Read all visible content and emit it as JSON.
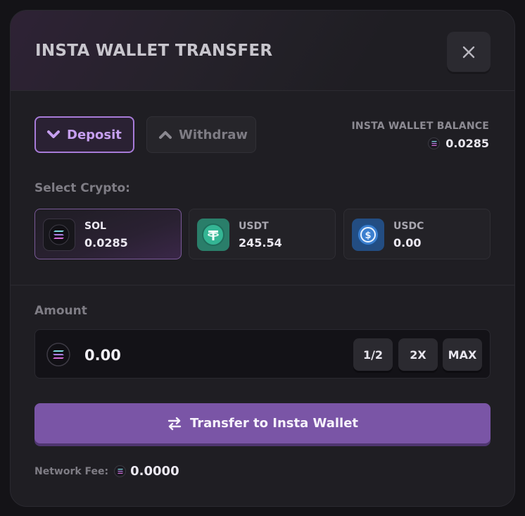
{
  "modal": {
    "title": "INSTA WALLET TRANSFER",
    "close_icon": "close-icon"
  },
  "tabs": [
    {
      "label": "Deposit",
      "icon": "chevron-down-icon",
      "active": true
    },
    {
      "label": "Withdraw",
      "icon": "chevron-up-icon",
      "active": false
    }
  ],
  "balance": {
    "label": "INSTA WALLET BALANCE",
    "value": "0.0285",
    "icon": "solana-icon"
  },
  "select_crypto": {
    "label": "Select Crypto:",
    "options": [
      {
        "name": "SOL",
        "balance": "0.0285",
        "icon": "solana-icon",
        "selected": true
      },
      {
        "name": "USDT",
        "balance": "245.54",
        "icon": "tether-icon",
        "selected": false
      },
      {
        "name": "USDC",
        "balance": "0.00",
        "icon": "usdc-icon",
        "selected": false
      }
    ]
  },
  "amount": {
    "label": "Amount",
    "value": "0.00",
    "icon": "solana-icon",
    "quick_buttons": [
      "1/2",
      "2X",
      "MAX"
    ]
  },
  "transfer_button": {
    "label": "Transfer to Insta Wallet",
    "icon": "swap-arrows-icon"
  },
  "fee": {
    "label": "Network Fee:",
    "value": "0.0000",
    "icon": "solana-icon"
  },
  "colors": {
    "accent": "#7a55a6",
    "deposit_active": "#c69ff0",
    "modal_bg": "#1f1e23",
    "usdt_green": "#2aa889",
    "usdc_blue": "#2d74c2"
  }
}
